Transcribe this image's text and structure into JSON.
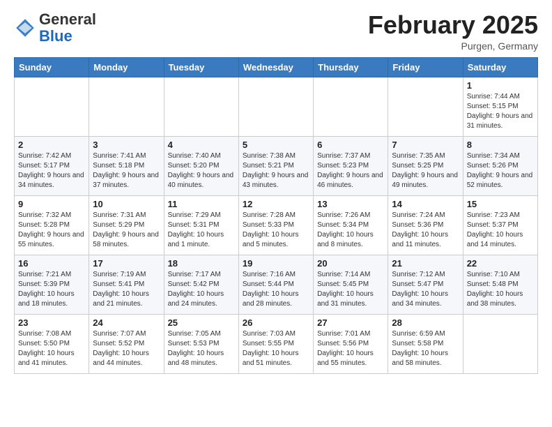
{
  "header": {
    "logo_general": "General",
    "logo_blue": "Blue",
    "month_title": "February 2025",
    "location": "Purgen, Germany"
  },
  "weekdays": [
    "Sunday",
    "Monday",
    "Tuesday",
    "Wednesday",
    "Thursday",
    "Friday",
    "Saturday"
  ],
  "weeks": [
    [
      {
        "day": "",
        "info": ""
      },
      {
        "day": "",
        "info": ""
      },
      {
        "day": "",
        "info": ""
      },
      {
        "day": "",
        "info": ""
      },
      {
        "day": "",
        "info": ""
      },
      {
        "day": "",
        "info": ""
      },
      {
        "day": "1",
        "info": "Sunrise: 7:44 AM\nSunset: 5:15 PM\nDaylight: 9 hours and 31 minutes."
      }
    ],
    [
      {
        "day": "2",
        "info": "Sunrise: 7:42 AM\nSunset: 5:17 PM\nDaylight: 9 hours and 34 minutes."
      },
      {
        "day": "3",
        "info": "Sunrise: 7:41 AM\nSunset: 5:18 PM\nDaylight: 9 hours and 37 minutes."
      },
      {
        "day": "4",
        "info": "Sunrise: 7:40 AM\nSunset: 5:20 PM\nDaylight: 9 hours and 40 minutes."
      },
      {
        "day": "5",
        "info": "Sunrise: 7:38 AM\nSunset: 5:21 PM\nDaylight: 9 hours and 43 minutes."
      },
      {
        "day": "6",
        "info": "Sunrise: 7:37 AM\nSunset: 5:23 PM\nDaylight: 9 hours and 46 minutes."
      },
      {
        "day": "7",
        "info": "Sunrise: 7:35 AM\nSunset: 5:25 PM\nDaylight: 9 hours and 49 minutes."
      },
      {
        "day": "8",
        "info": "Sunrise: 7:34 AM\nSunset: 5:26 PM\nDaylight: 9 hours and 52 minutes."
      }
    ],
    [
      {
        "day": "9",
        "info": "Sunrise: 7:32 AM\nSunset: 5:28 PM\nDaylight: 9 hours and 55 minutes."
      },
      {
        "day": "10",
        "info": "Sunrise: 7:31 AM\nSunset: 5:29 PM\nDaylight: 9 hours and 58 minutes."
      },
      {
        "day": "11",
        "info": "Sunrise: 7:29 AM\nSunset: 5:31 PM\nDaylight: 10 hours and 1 minute."
      },
      {
        "day": "12",
        "info": "Sunrise: 7:28 AM\nSunset: 5:33 PM\nDaylight: 10 hours and 5 minutes."
      },
      {
        "day": "13",
        "info": "Sunrise: 7:26 AM\nSunset: 5:34 PM\nDaylight: 10 hours and 8 minutes."
      },
      {
        "day": "14",
        "info": "Sunrise: 7:24 AM\nSunset: 5:36 PM\nDaylight: 10 hours and 11 minutes."
      },
      {
        "day": "15",
        "info": "Sunrise: 7:23 AM\nSunset: 5:37 PM\nDaylight: 10 hours and 14 minutes."
      }
    ],
    [
      {
        "day": "16",
        "info": "Sunrise: 7:21 AM\nSunset: 5:39 PM\nDaylight: 10 hours and 18 minutes."
      },
      {
        "day": "17",
        "info": "Sunrise: 7:19 AM\nSunset: 5:41 PM\nDaylight: 10 hours and 21 minutes."
      },
      {
        "day": "18",
        "info": "Sunrise: 7:17 AM\nSunset: 5:42 PM\nDaylight: 10 hours and 24 minutes."
      },
      {
        "day": "19",
        "info": "Sunrise: 7:16 AM\nSunset: 5:44 PM\nDaylight: 10 hours and 28 minutes."
      },
      {
        "day": "20",
        "info": "Sunrise: 7:14 AM\nSunset: 5:45 PM\nDaylight: 10 hours and 31 minutes."
      },
      {
        "day": "21",
        "info": "Sunrise: 7:12 AM\nSunset: 5:47 PM\nDaylight: 10 hours and 34 minutes."
      },
      {
        "day": "22",
        "info": "Sunrise: 7:10 AM\nSunset: 5:48 PM\nDaylight: 10 hours and 38 minutes."
      }
    ],
    [
      {
        "day": "23",
        "info": "Sunrise: 7:08 AM\nSunset: 5:50 PM\nDaylight: 10 hours and 41 minutes."
      },
      {
        "day": "24",
        "info": "Sunrise: 7:07 AM\nSunset: 5:52 PM\nDaylight: 10 hours and 44 minutes."
      },
      {
        "day": "25",
        "info": "Sunrise: 7:05 AM\nSunset: 5:53 PM\nDaylight: 10 hours and 48 minutes."
      },
      {
        "day": "26",
        "info": "Sunrise: 7:03 AM\nSunset: 5:55 PM\nDaylight: 10 hours and 51 minutes."
      },
      {
        "day": "27",
        "info": "Sunrise: 7:01 AM\nSunset: 5:56 PM\nDaylight: 10 hours and 55 minutes."
      },
      {
        "day": "28",
        "info": "Sunrise: 6:59 AM\nSunset: 5:58 PM\nDaylight: 10 hours and 58 minutes."
      },
      {
        "day": "",
        "info": ""
      }
    ]
  ]
}
